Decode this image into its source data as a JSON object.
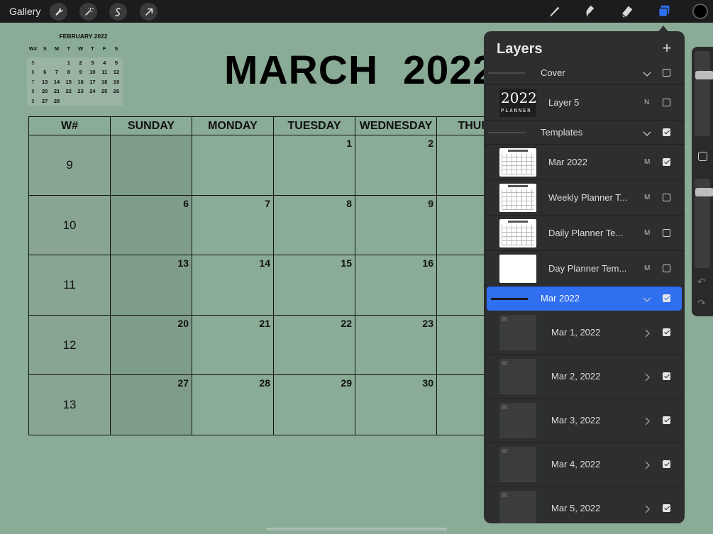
{
  "toolbar": {
    "gallery_label": "Gallery",
    "left_tools": [
      "wrench-icon",
      "magic-wand-icon",
      "selection-icon",
      "transform-arrow-icon"
    ],
    "right_tools": [
      "brush-icon",
      "smudge-icon",
      "eraser-icon",
      "layers-icon"
    ],
    "accent": "#2f6ff0",
    "current_color": "#000000"
  },
  "mini_calendar": {
    "title": "FEBRUARY  2022",
    "headers": [
      "W#",
      "S",
      "M",
      "T",
      "W",
      "T",
      "F",
      "S"
    ],
    "rows": [
      [
        "5",
        "",
        "",
        "1",
        "2",
        "3",
        "4",
        "5"
      ],
      [
        "6",
        "6",
        "7",
        "8",
        "9",
        "10",
        "11",
        "12"
      ],
      [
        "7",
        "13",
        "14",
        "15",
        "16",
        "17",
        "18",
        "19"
      ],
      [
        "8",
        "20",
        "21",
        "22",
        "23",
        "24",
        "25",
        "26"
      ],
      [
        "9",
        "27",
        "28",
        "",
        "",
        "",
        "",
        ""
      ]
    ]
  },
  "calendar": {
    "title": "MARCH  2022",
    "headers": [
      "W#",
      "SUNDAY",
      "MONDAY",
      "TUESDAY",
      "WEDNESDAY",
      "THURS"
    ],
    "weeks": [
      {
        "wk": "9",
        "days": [
          "",
          "",
          "1",
          "2",
          ""
        ]
      },
      {
        "wk": "10",
        "days": [
          "6",
          "7",
          "8",
          "9",
          ""
        ]
      },
      {
        "wk": "11",
        "days": [
          "13",
          "14",
          "15",
          "16",
          ""
        ]
      },
      {
        "wk": "12",
        "days": [
          "20",
          "21",
          "22",
          "23",
          ""
        ]
      },
      {
        "wk": "13",
        "days": [
          "27",
          "28",
          "29",
          "30",
          ""
        ]
      }
    ]
  },
  "layers_panel": {
    "title": "Layers",
    "add_label": "+",
    "rows": [
      {
        "kind": "group",
        "name": "Cover",
        "checked": false,
        "chevron": "down"
      },
      {
        "kind": "layer",
        "name": "Layer 5",
        "mode": "N",
        "checked": false,
        "thumb": "planner-cover"
      },
      {
        "kind": "group",
        "name": "Templates",
        "checked": true,
        "chevron": "down"
      },
      {
        "kind": "layer",
        "name": "Mar 2022",
        "mode": "M",
        "checked": true,
        "thumb": "calendar"
      },
      {
        "kind": "layer",
        "name": "Weekly Planner T...",
        "mode": "M",
        "checked": false,
        "thumb": "calendar"
      },
      {
        "kind": "layer",
        "name": "Daily Planner Te...",
        "mode": "M",
        "checked": false,
        "thumb": "calendar"
      },
      {
        "kind": "layer",
        "name": "Day Planner Tem...",
        "mode": "M",
        "checked": false,
        "thumb": "blank"
      },
      {
        "kind": "group",
        "name": "Mar 2022",
        "checked": true,
        "chevron": "down",
        "selected": true
      },
      {
        "kind": "sub",
        "name": "Mar 1, 2022",
        "checked": true,
        "chevron": "right"
      },
      {
        "kind": "sub",
        "name": "Mar 2, 2022",
        "checked": true,
        "chevron": "right"
      },
      {
        "kind": "sub",
        "name": "Mar 3, 2022",
        "checked": true,
        "chevron": "right"
      },
      {
        "kind": "sub",
        "name": "Mar 4, 2022",
        "checked": true,
        "chevron": "right"
      },
      {
        "kind": "sub",
        "name": "Mar 5, 2022",
        "checked": true,
        "chevron": "right"
      }
    ],
    "cover_thumb_text": "2022",
    "cover_thumb_sub": "PLANNER"
  },
  "sidebar_controls": {
    "brush_size": 0.28,
    "opacity": 0.12
  }
}
